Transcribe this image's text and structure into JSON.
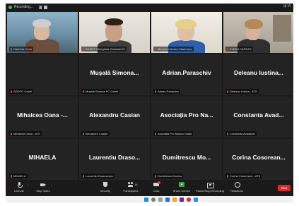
{
  "topbar": {
    "recording_label": "Recording...",
    "view_label": "⊞ Vi"
  },
  "tiles": [
    {
      "id": "t1",
      "type": "video",
      "label": "Gabriela Cretu"
    },
    {
      "id": "t2",
      "type": "video",
      "label": "ACSDT Gherghina Octaviani M"
    },
    {
      "id": "t3",
      "type": "video",
      "label": "Mihaela Carmen Marinescu",
      "active": true
    },
    {
      "id": "t4",
      "type": "video",
      "label": "ELENA CARDAS"
    },
    {
      "id": "t5",
      "type": "name",
      "name": "",
      "label": "ADDPO Galati"
    },
    {
      "id": "t6",
      "type": "name",
      "name": "Mușală Simona...",
      "label": "Mușală Simona PC Galati"
    },
    {
      "id": "t7",
      "type": "name",
      "name": "Adrian.Paraschiv",
      "label": "Adrian.Paraschiv"
    },
    {
      "id": "t8",
      "type": "name",
      "name": "Deleanu Iustina...",
      "label": "Deleanu Iustina - ATS"
    },
    {
      "id": "t9",
      "type": "name",
      "name": "Mihalcea Oana -...",
      "label": "Mihalcea Oana - ATS"
    },
    {
      "id": "t10",
      "type": "name",
      "name": "Alexandru Casian",
      "label": "Alexandru Casian"
    },
    {
      "id": "t11",
      "type": "name",
      "name": "Asociația Pro Na...",
      "label": "Asociatia Pro Natura Galati"
    },
    {
      "id": "t12",
      "type": "name",
      "name": "Constanta Avad...",
      "label": "Constanta Avadanei"
    },
    {
      "id": "t13",
      "type": "name",
      "name": "MIHAELA",
      "label": "MIHAELA"
    },
    {
      "id": "t14",
      "type": "name",
      "name": "Laurentiu Draso...",
      "label": "Laurentiu Drasoveanu"
    },
    {
      "id": "t15",
      "type": "name",
      "name": "Dumitrescu Mo...",
      "label": "Dumitrescu Monica"
    },
    {
      "id": "t16",
      "type": "name",
      "name": "Corina Cosorean...",
      "label": "Corina Cosoreanu - ATS"
    }
  ],
  "toolbar": {
    "unmute_label": "Unmute",
    "stop_video_label": "Stop Video",
    "security_label": "Security",
    "participants_label": "Participants",
    "participants_count": "16",
    "chat_label": "Chat",
    "share_screen_label": "Share Screen",
    "pause_recording_label": "Pause/Stop Recording",
    "reactions_label": "Reactions",
    "end_label": "End"
  },
  "colors": {
    "active_speaker": "#9bc53d",
    "end_button": "#e02828",
    "share_green": "#43a047",
    "muted_red": "#e53935"
  }
}
